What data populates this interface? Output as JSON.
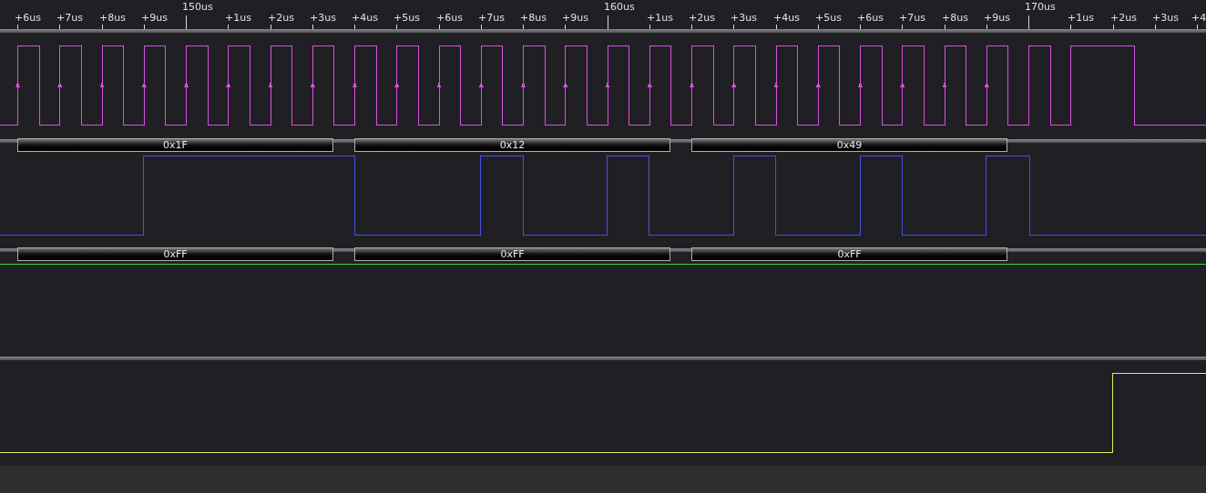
{
  "ruler": {
    "ticks": [
      {
        "label": "+6us",
        "kind": "minor"
      },
      {
        "label": "+7us",
        "kind": "minor"
      },
      {
        "label": "+8us",
        "kind": "minor"
      },
      {
        "label": "+9us",
        "kind": "minor"
      },
      {
        "label": "150us",
        "kind": "major"
      },
      {
        "label": "+1us",
        "kind": "minor"
      },
      {
        "label": "+2us",
        "kind": "minor"
      },
      {
        "label": "+3us",
        "kind": "minor"
      },
      {
        "label": "+4us",
        "kind": "minor"
      },
      {
        "label": "+5us",
        "kind": "minor"
      },
      {
        "label": "+6us",
        "kind": "minor"
      },
      {
        "label": "+7us",
        "kind": "minor"
      },
      {
        "label": "+8us",
        "kind": "minor"
      },
      {
        "label": "+9us",
        "kind": "minor"
      },
      {
        "label": "160us",
        "kind": "major"
      },
      {
        "label": "+1us",
        "kind": "minor"
      },
      {
        "label": "+2us",
        "kind": "minor"
      },
      {
        "label": "+3us",
        "kind": "minor"
      },
      {
        "label": "+4us",
        "kind": "minor"
      },
      {
        "label": "+5us",
        "kind": "minor"
      },
      {
        "label": "+6us",
        "kind": "minor"
      },
      {
        "label": "+7us",
        "kind": "minor"
      },
      {
        "label": "+8us",
        "kind": "minor"
      },
      {
        "label": "+9us",
        "kind": "minor"
      },
      {
        "label": "170us",
        "kind": "major"
      },
      {
        "label": "+1us",
        "kind": "minor"
      },
      {
        "label": "+2us",
        "kind": "minor"
      },
      {
        "label": "+3us",
        "kind": "minor"
      },
      {
        "label": "+4",
        "kind": "minor"
      }
    ]
  },
  "channels": [
    {
      "color": "#d94fe0",
      "decoded": [
        "0x1F",
        "0x12",
        "0x49"
      ]
    },
    {
      "color": "#4a4fe0",
      "decoded": [
        "0xFF",
        "0xFF",
        "0xFF"
      ]
    },
    {
      "color": "#3fd03f"
    },
    {
      "color": "#e8e860"
    }
  ]
}
